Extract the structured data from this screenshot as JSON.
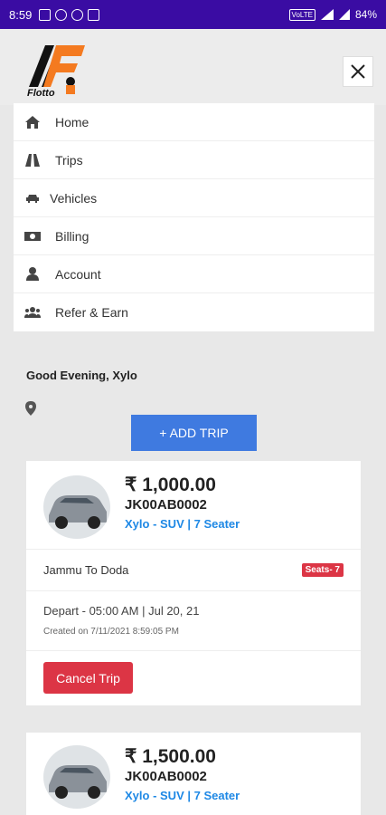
{
  "status_bar": {
    "time": "8:59",
    "network": "VoLTE",
    "signal_label": "4G",
    "battery": "84%"
  },
  "brand": {
    "logo_text": "Flotto"
  },
  "menu": {
    "items": [
      {
        "label": "Home",
        "icon": "home-icon"
      },
      {
        "label": "Trips",
        "icon": "road-icon"
      },
      {
        "label": "Vehicles",
        "icon": "car-icon"
      },
      {
        "label": "Billing",
        "icon": "money-icon"
      },
      {
        "label": "Account",
        "icon": "user-icon"
      },
      {
        "label": "Refer & Earn",
        "icon": "users-icon"
      }
    ]
  },
  "greeting": "Good Evening, Xylo",
  "add_trip_label": "+ ADD TRIP",
  "trips": [
    {
      "price": "₹ 1,000.00",
      "registration": "JK00AB0002",
      "model": "Xylo - SUV | 7 Seater",
      "route": "Jammu To Doda",
      "seats": "Seats- 7",
      "depart": "Depart - 05:00 AM | Jul 20, 21",
      "created": "Created on 7/11/2021 8:59:05 PM",
      "cancel_label": "Cancel Trip"
    },
    {
      "price": "₹ 1,500.00",
      "registration": "JK00AB0002",
      "model": "Xylo - SUV | 7 Seater"
    }
  ],
  "colors": {
    "status_bar": "#3a0ca3",
    "primary": "#3f7ae0",
    "danger": "#dc3545",
    "link": "#1e88e5",
    "logo_orange": "#f47a20"
  }
}
